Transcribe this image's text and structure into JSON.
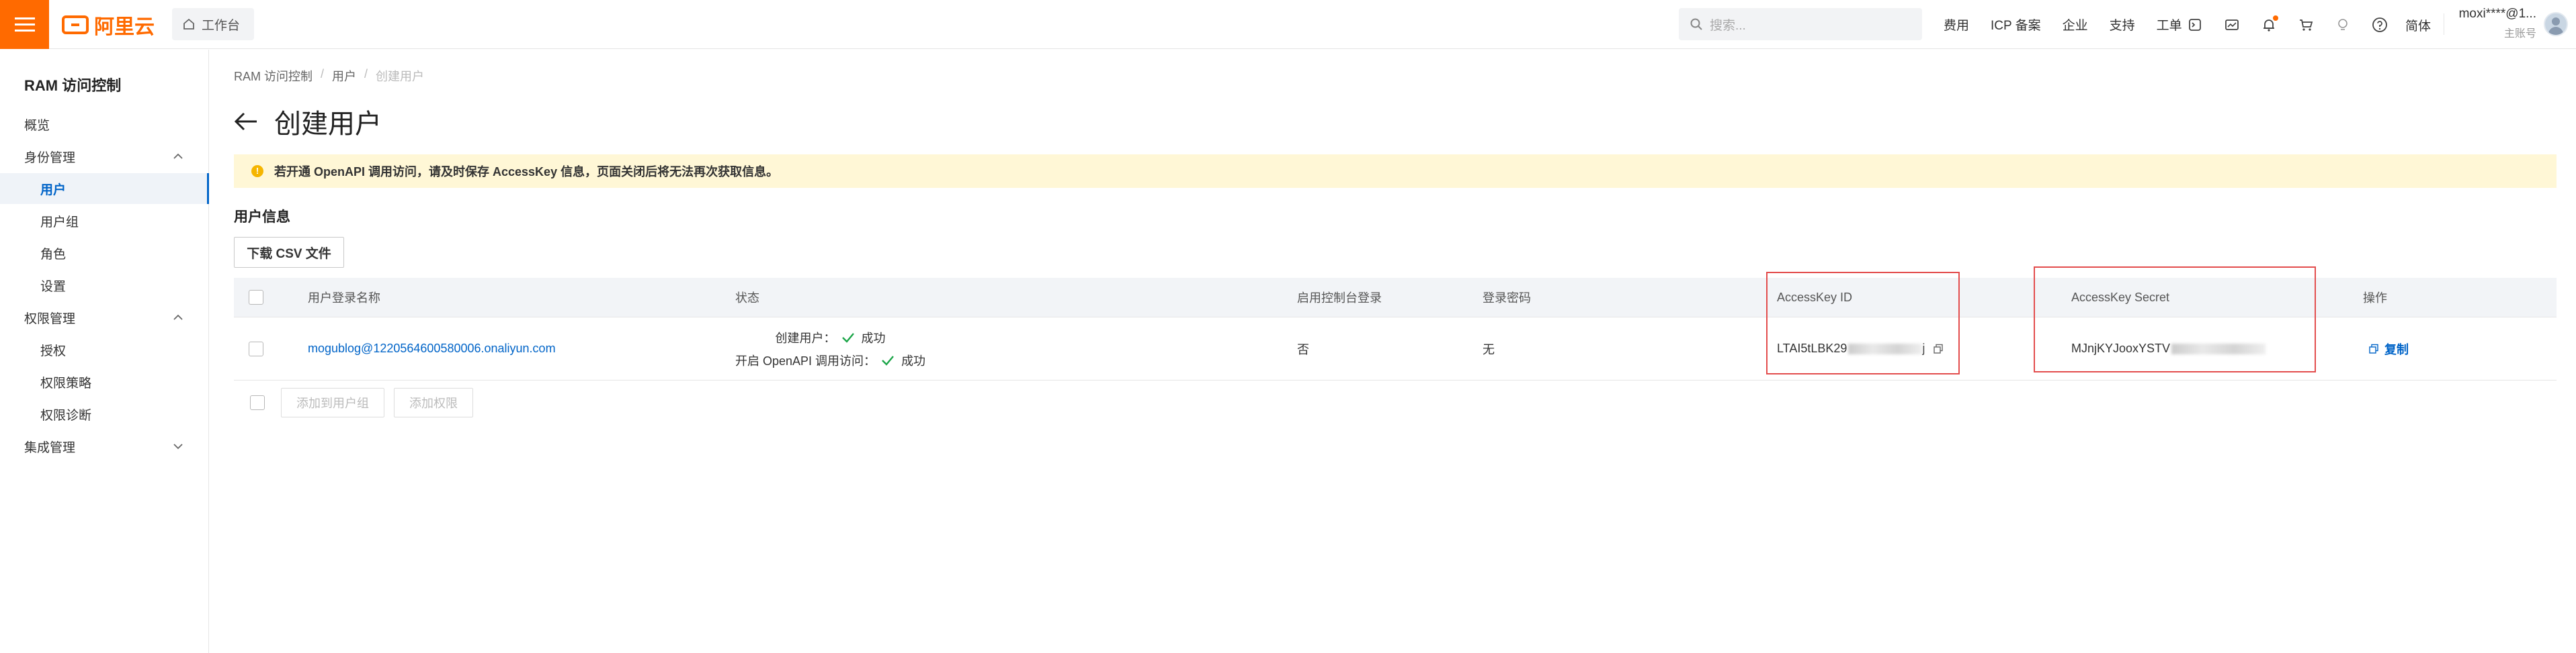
{
  "topbar": {
    "brand": "阿里云",
    "workbench": "工作台",
    "search_placeholder": "搜索...",
    "nav": [
      "费用",
      "ICP 备案",
      "企业",
      "支持",
      "工单"
    ],
    "icons": [
      "terminal-icon",
      "message-icon",
      "bell-icon",
      "cart-icon",
      "lightbulb-icon",
      "help-icon"
    ],
    "language": "简体",
    "account_name": "moxi****@1...",
    "account_role": "主账号"
  },
  "sidebar": {
    "title": "RAM 访问控制",
    "items": [
      {
        "label": "概览"
      },
      {
        "label": "身份管理"
      },
      {
        "label": "用户"
      },
      {
        "label": "用户组"
      },
      {
        "label": "角色"
      },
      {
        "label": "设置"
      },
      {
        "label": "权限管理"
      },
      {
        "label": "授权"
      },
      {
        "label": "权限策略"
      },
      {
        "label": "权限诊断"
      },
      {
        "label": "集成管理"
      }
    ]
  },
  "breadcrumb": [
    "RAM 访问控制",
    "用户",
    "创建用户"
  ],
  "page": {
    "title": "创建用户",
    "notice": "若开通 OpenAPI 调用访问，请及时保存 AccessKey 信息，页面关闭后将无法再次获取信息。",
    "section_title": "用户信息",
    "download_csv": "下载 CSV 文件"
  },
  "table": {
    "headers": [
      "用户登录名称",
      "状态",
      "启用控制台登录",
      "登录密码",
      "AccessKey ID",
      "AccessKey Secret",
      "操作"
    ],
    "row": {
      "login_name": "mogublog@1220564600580006.onaliyun.com",
      "status_create_label": "创建用户：",
      "status_create_value": "成功",
      "status_api_label": "开启 OpenAPI 调用访问：",
      "status_api_value": "成功",
      "console_login": "否",
      "password": "无",
      "access_key_id": "LTAI5tLBK29",
      "access_key_id_tail": "j",
      "access_key_secret": "MJnjKYJooxYSTV",
      "action": "复制"
    }
  },
  "batch_actions": [
    "添加到用户组",
    "添加权限"
  ],
  "colors": {
    "brand_orange": "#ff6a00",
    "link_blue": "#0064c8",
    "notice_bg": "#fff7d6",
    "success_green": "#1ba548",
    "highlight_red": "#e34d4d"
  }
}
